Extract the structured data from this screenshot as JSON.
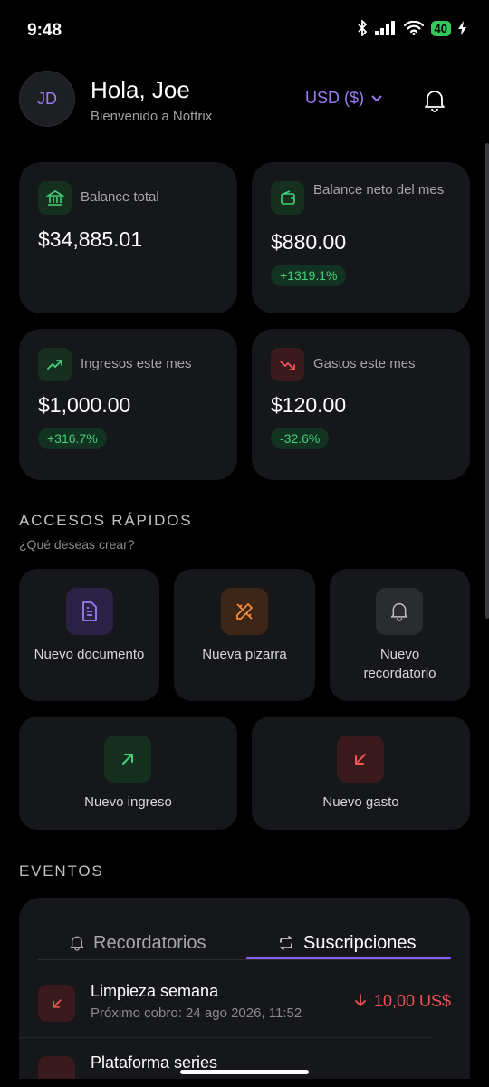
{
  "status": {
    "time": "9:48",
    "battery": "40"
  },
  "header": {
    "avatar_initials": "JD",
    "greeting": "Hola, Joe",
    "subtitle": "Bienvenido a Nottrix",
    "currency": "USD ($)"
  },
  "summary": {
    "total_balance": {
      "label": "Balance total",
      "value": "$34,885.01"
    },
    "net_balance": {
      "label": "Balance neto del mes",
      "value": "$880.00",
      "change": "+1319.1%"
    },
    "income": {
      "label": "Ingresos este mes",
      "value": "$1,000.00",
      "change": "+316.7%"
    },
    "expenses": {
      "label": "Gastos este mes",
      "value": "$120.00",
      "change": "-32.6%"
    }
  },
  "quick_access": {
    "title": "ACCESOS RÁPIDOS",
    "subtitle": "¿Qué deseas crear?",
    "items": [
      {
        "label": "Nuevo documento"
      },
      {
        "label": "Nueva pizarra"
      },
      {
        "label": "Nuevo recordatorio"
      },
      {
        "label": "Nuevo ingreso"
      },
      {
        "label": "Nuevo gasto"
      }
    ]
  },
  "events": {
    "title": "EVENTOS",
    "tabs": [
      {
        "label": "Recordatorios"
      },
      {
        "label": "Suscripciones"
      }
    ],
    "active_tab": "Suscripciones",
    "rows": [
      {
        "title": "Limpieza semana",
        "subtitle": "Próximo cobro: 24 ago 2026, 11:52",
        "amount": "10,00 US$"
      },
      {
        "title": "Plataforma series"
      }
    ]
  },
  "colors": {
    "accent": "#8b5cf6",
    "positive": "#46d07a",
    "negative": "#f05454",
    "card_bg": "#16171a"
  }
}
